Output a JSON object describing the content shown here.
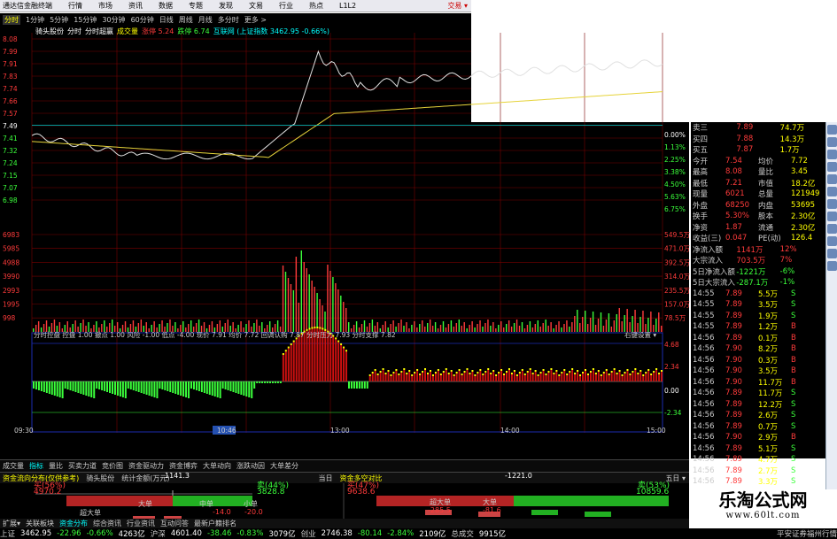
{
  "window": {
    "title": "通达信金融终端",
    "menus": [
      "行情",
      "市场",
      "资讯",
      "数据",
      "专题",
      "发现",
      "文易",
      "行业",
      "热点",
      "L1L2"
    ],
    "brand": "交易 ▾"
  },
  "tabs": [
    "分时",
    "1分钟",
    "5分钟",
    "15分钟",
    "30分钟",
    "60分钟",
    "日线",
    "周线",
    "月线",
    "多分时",
    "更多 >"
  ],
  "info": {
    "name": "骑头股份",
    "t1": "分时",
    "t2": "分时超赢",
    "vol_label": "成交量",
    "up_label": "涨停 5.24",
    "down_label": "跌停 6.74",
    "index": "互联网 (上证指数 3462.95 -0.66%)"
  },
  "yaxis_price": [
    "8.08",
    "7.99",
    "7.91",
    "7.83",
    "7.74",
    "7.66",
    "7.57",
    "7.49",
    "7.41",
    "7.32",
    "7.24",
    "7.15",
    "7.07",
    "6.98"
  ],
  "yaxis_pct": [
    "0.00%",
    "1.13%",
    "2.25%",
    "3.38%",
    "4.50%",
    "5.63%",
    "6.75%"
  ],
  "yaxis_vol": [
    "6983",
    "5985",
    "4988",
    "3990",
    "2993",
    "1995",
    "998"
  ],
  "yaxis_vol_r": [
    "549.5万",
    "471.0万",
    "392.5万",
    "314.0万",
    "235.5万",
    "157.0万",
    "78.5万"
  ],
  "ind_bar": {
    "text": "分时控盘 控盘 1.00  撤点 1.00  风险 -1.00  低点 -4.00  现价 7.91  均价 7.72  回调认购 7.87  分时压力 7.93  分时支撑 7.82",
    "right": "右键设置 ▾"
  },
  "ind_axis": [
    "4.68",
    "2.34",
    "0.00",
    "-2.34"
  ],
  "time_labels": [
    "09:30",
    "10:46",
    "13:00",
    "14:00",
    "15:00"
  ],
  "quote": [
    [
      "卖三",
      "7.89",
      "74.7万"
    ],
    [
      "买四",
      "7.88",
      "14.3万"
    ],
    [
      "买五",
      "7.87",
      "1.7万"
    ],
    [
      "今开",
      "7.54",
      "均价",
      "7.72"
    ],
    [
      "最高",
      "8.08",
      "量比",
      "3.45"
    ],
    [
      "最低",
      "7.21",
      "市值",
      "18.2亿"
    ],
    [
      "现量",
      "6021",
      "总量",
      "121949"
    ],
    [
      "外盘",
      "68250",
      "内盘",
      "53695"
    ],
    [
      "换手",
      "5.30%",
      "股本",
      "2.30亿"
    ],
    [
      "净资",
      "1.87",
      "流通",
      "2.30亿"
    ],
    [
      "收益(三)",
      "0.047",
      "PE(动)",
      "126.4"
    ]
  ],
  "flows": [
    [
      "净流入额",
      "1141万",
      "12%"
    ],
    [
      "大宗流入",
      "703.5万",
      "7%"
    ],
    [
      "5日净流入额",
      "-1221万",
      "-6%"
    ],
    [
      "5日大宗流入",
      "-287.1万",
      "-1%"
    ]
  ],
  "ticks": [
    [
      "14:55",
      "7.89",
      "5.5万",
      "S"
    ],
    [
      "14:55",
      "7.89",
      "3.5万",
      "S"
    ],
    [
      "14:55",
      "7.89",
      "1.9万",
      "S"
    ],
    [
      "14:55",
      "7.89",
      "1.2万",
      "B"
    ],
    [
      "14:56",
      "7.89",
      "0.1万",
      "B"
    ],
    [
      "14:56",
      "7.90",
      "8.2万",
      "B"
    ],
    [
      "14:56",
      "7.90",
      "0.3万",
      "B"
    ],
    [
      "14:56",
      "7.90",
      "3.5万",
      "B"
    ],
    [
      "14:56",
      "7.90",
      "11.7万",
      "B"
    ],
    [
      "14:56",
      "7.89",
      "11.7万",
      "S"
    ],
    [
      "14:56",
      "7.89",
      "12.2万",
      "S"
    ],
    [
      "14:56",
      "7.89",
      "2.6万",
      "S"
    ],
    [
      "14:56",
      "7.89",
      "0.7万",
      "S"
    ],
    [
      "14:56",
      "7.90",
      "2.9万",
      "B"
    ],
    [
      "14:56",
      "7.89",
      "5.1万",
      "S"
    ],
    [
      "14:56",
      "7.89",
      "4.7万",
      "S"
    ],
    [
      "14:56",
      "7.89",
      "2.7万",
      "S"
    ],
    [
      "14:56",
      "7.89",
      "3.3万",
      "S"
    ]
  ],
  "tick_tip": "A股委托单 ▾",
  "bottom_tabs": [
    "成交量",
    "指标",
    "量比",
    "买卖力道",
    "竞价图",
    "资金驱动力",
    "资金博弈",
    "大单动向",
    "涨跌动因",
    "大单差分"
  ],
  "panel_left": {
    "title": "资金流向分布(仅供参考)",
    "stock": "骑头股份",
    "sub": "统计金额(万元)",
    "buy_pct": "买(56%)",
    "buy_val": "4970.2",
    "sell_pct": "卖(44%)",
    "sell_val": "3828.8",
    "net": "1141.3",
    "legend": [
      "超大单",
      "大单",
      "中单",
      "小单"
    ],
    "vals": [
      "-14.0",
      "-20.0"
    ]
  },
  "panel_right": {
    "title": "资金多空对比",
    "day": "当日",
    "five": "五日 ▾",
    "buy_pct": "买(47%)",
    "buy_val": "9638.6",
    "sell_pct": "卖(53%)",
    "sell_val": "10859.6",
    "net": "-1221.0",
    "legend": [
      "超大单",
      "大单"
    ],
    "vals": [
      "-285.5",
      "-81.6"
    ]
  },
  "under_tabs": [
    "扩展▾",
    "关联板块",
    "资金分布",
    "综合资讯",
    "行业资讯",
    "互动问答",
    "最新户籍排名"
  ],
  "status": [
    [
      "上证",
      "3462.95",
      "-22.96",
      "-0.66%",
      "4263亿"
    ],
    [
      "沪深",
      "4601.40",
      "-38.46",
      "-0.83%",
      "3079亿"
    ],
    [
      "创业",
      "2746.38",
      "-80.14",
      "-2.84%",
      "2109亿"
    ],
    [
      "总成交",
      "9915亿",
      "",
      "",
      ""
    ]
  ],
  "status_right": "平安证券福州行情",
  "watermark": {
    "cn": "乐淘公式网",
    "url": "www.60lt.com"
  },
  "colors": {
    "up": "#ff3b3b",
    "down": "#3bff3b",
    "price_line": "#e0e0e0",
    "avg_line": "#e6d33a"
  }
}
